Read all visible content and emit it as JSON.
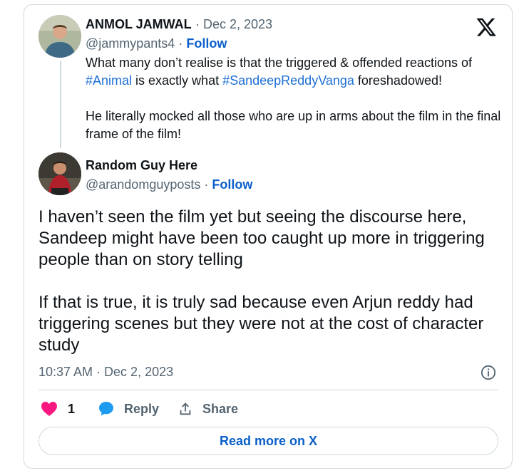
{
  "quoted": {
    "author_name": "ANMOL JAMWAL",
    "separator": " · ",
    "date": "Dec 2, 2023",
    "handle": "@jammypants4",
    "follow_label": "Follow",
    "text_line1_a": "What many don’t realise is that the triggered & offended reactions of",
    "hashtag1": "#Animal",
    "text_line2_mid": " is exactly what ",
    "hashtag2": "#SandeepReddyVanga",
    "text_line2_end": " foreshadowed!",
    "paragraph2": "He literally mocked all those who are up in arms about the film in the final frame of the film!"
  },
  "tweet": {
    "author_name": "Random Guy Here",
    "handle": "@arandomguyposts",
    "separator": " · ",
    "follow_label": "Follow",
    "paragraph1": "I haven’t seen the film yet but seeing the discourse here, Sandeep might have been too caught up more in triggering people than on story telling",
    "paragraph2": "If that is true, it is truly sad because even Arjun reddy had triggering scenes but they were not at the cost of character study",
    "timestamp": "10:37 AM · Dec 2, 2023"
  },
  "actions": {
    "like_count": "1",
    "reply_label": "Reply",
    "share_label": "Share"
  },
  "read_more_label": "Read more on X",
  "icons": {
    "logo": "x-logo-icon",
    "info": "info-icon",
    "like": "heart-icon",
    "reply": "reply-bubble-icon",
    "share": "share-icon"
  },
  "colors": {
    "link": "#1d6fd6",
    "follow": "#0a5fc9",
    "heart": "#f91880",
    "reply": "#1d9bf0",
    "muted": "#536471",
    "border": "#cfd9de"
  }
}
